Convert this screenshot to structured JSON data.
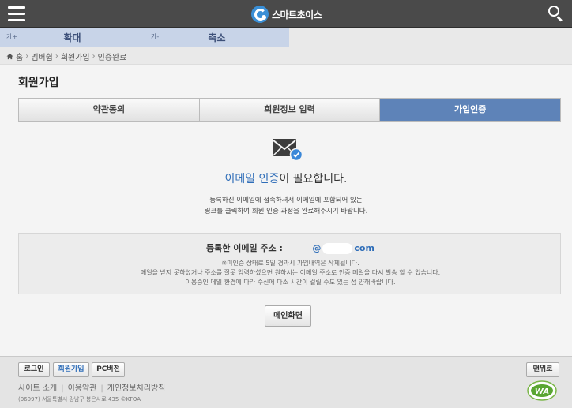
{
  "header": {
    "logo_text": "스마트초이스",
    "menu_icon": "hamburger-menu-icon",
    "search_icon": "search-icon"
  },
  "zoom": {
    "enlarge_prefix": "가+",
    "enlarge_label": "확대",
    "shrink_prefix": "가-",
    "shrink_label": "축소"
  },
  "breadcrumb": {
    "home": "홈",
    "items": [
      "멤버쉽",
      "회원가입",
      "인증완료"
    ],
    "separator": "›"
  },
  "page": {
    "title": "회원가입"
  },
  "steps": [
    {
      "label": "약관동의",
      "active": false
    },
    {
      "label": "회원정보 입력",
      "active": false
    },
    {
      "label": "가입인증",
      "active": true
    }
  ],
  "verify": {
    "title_highlight": "이메일 인증",
    "title_rest": "이 필요합니다.",
    "desc_line1": "등록하신 이메일에 접속하셔서 이메일에 포함되어 있는",
    "desc_line2": "링크를 클릭하여 회원 인증 과정을 완료해주시기 바랍니다."
  },
  "info": {
    "email_label": "등록한 이메일 주소 :",
    "email_prefix": "@",
    "email_suffix": "com",
    "note1": "※미인증 상태로 5일 경과시 가입내역은 삭제됩니다.",
    "note2": "메일을 받지 못하셨거나 주소를 잘못 입력하셨으면 원하시는 이메일 주소로 인증 메일을 다시 발송 할 수 있습니다.",
    "note3": "이용중인 메일 환경에 따라 수신에 다소 시간이 걸릴 수도 있는 점 양해바랍니다."
  },
  "main_button": "메인화면",
  "footer": {
    "login": "로그인",
    "join": "회원가입",
    "pc_version": "PC버전",
    "top": "맨위로",
    "links": [
      "사이트 소개",
      "이용약관",
      "개인정보처리방침"
    ],
    "address": "(06097) 서울특별시 강남구 봉은사로 435 ©KTOA",
    "badge_text": "WA"
  },
  "colors": {
    "topbar": "#4a4a4a",
    "accent_blue": "#2e6db8",
    "active_step": "#5e83b8"
  }
}
